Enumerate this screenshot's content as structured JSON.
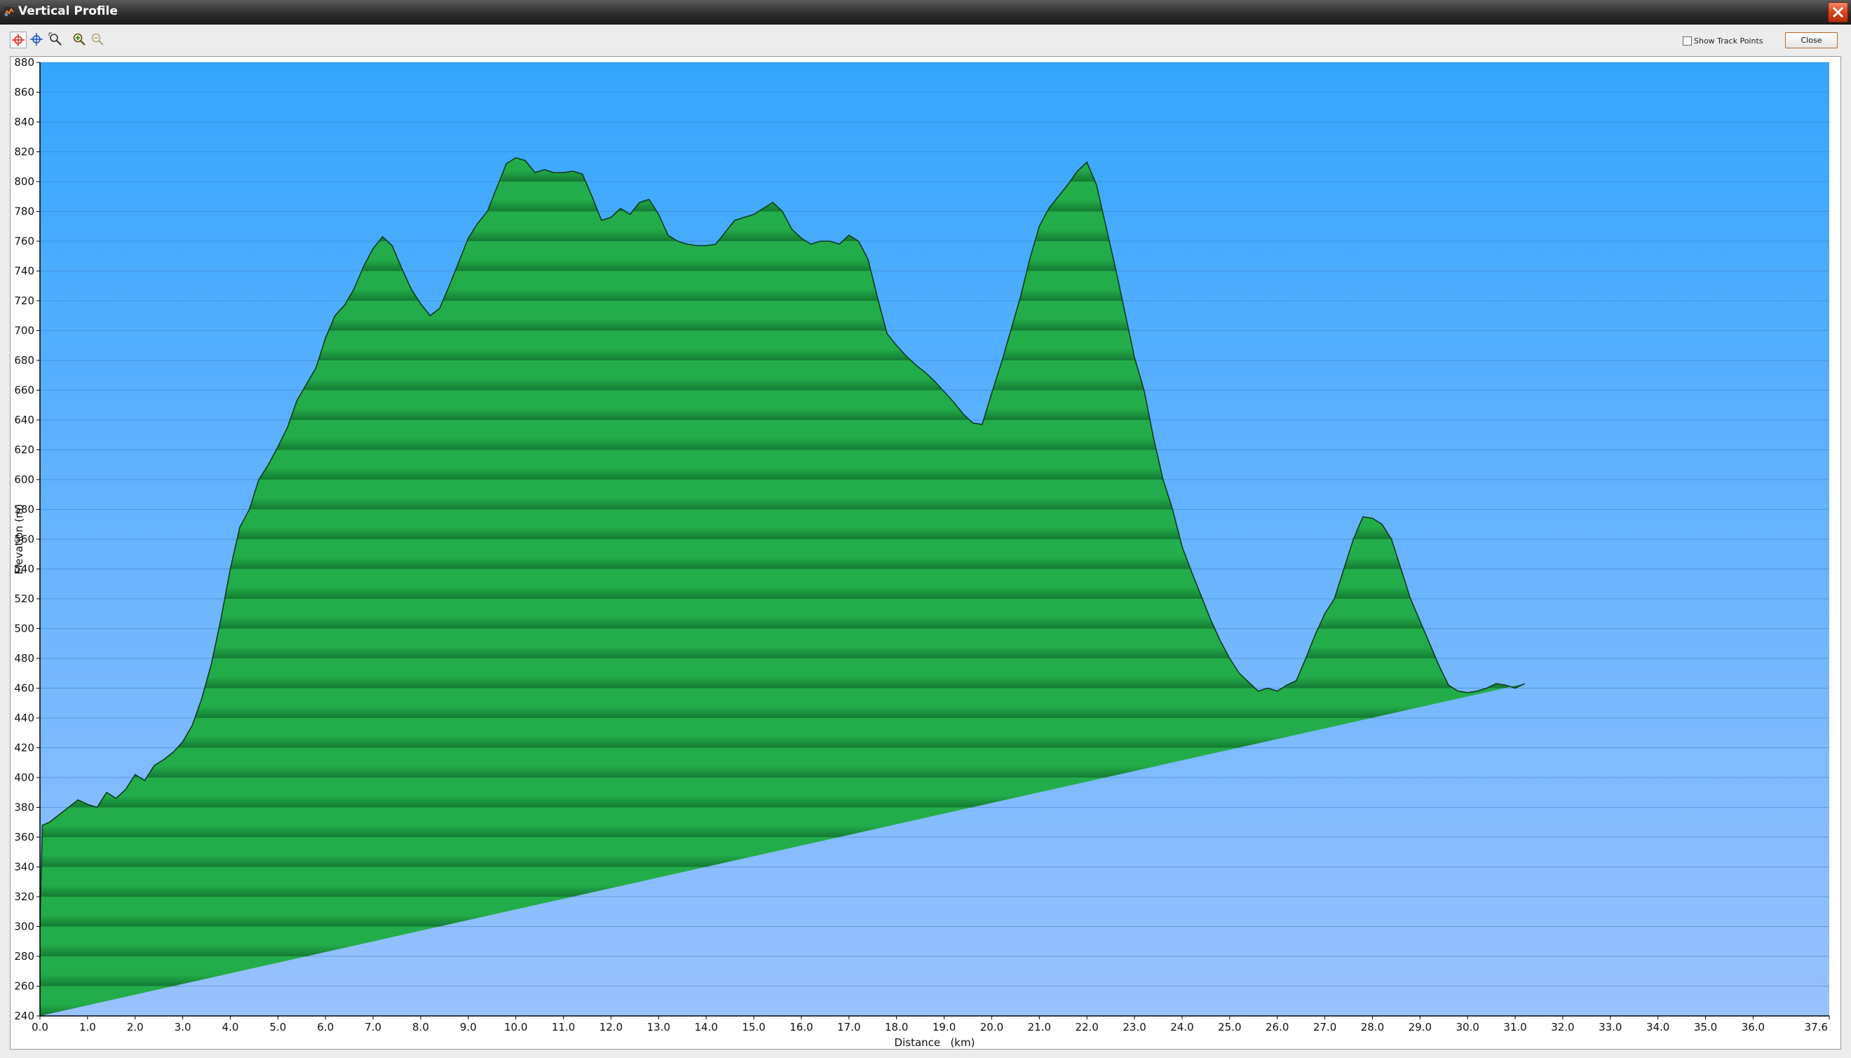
{
  "window": {
    "title": "Vertical Profile",
    "icon": "profile-app-icon",
    "close_icon": "close-icon"
  },
  "toolbar": {
    "tools": [
      {
        "name": "select-point-tool",
        "icon": "red-crosshair-icon",
        "active": true
      },
      {
        "name": "pan-crosshair-tool",
        "icon": "blue-crosshair-icon",
        "active": false
      },
      {
        "name": "zoom-region-tool",
        "icon": "zoom-region-icon",
        "active": false
      },
      {
        "name": "zoom-in-tool",
        "icon": "zoom-in-icon",
        "active": false
      },
      {
        "name": "zoom-out-tool",
        "icon": "zoom-out-icon",
        "active": false
      }
    ],
    "show_track_points_label": "Show Track Points",
    "show_track_points_checked": false,
    "close_label": "Close"
  },
  "colors": {
    "sky_top": "#35a6fd",
    "sky_bottom": "#99c1ff",
    "fill_light": "#23ad4a",
    "fill_dark": "#147a33",
    "outline": "#0d3a1a",
    "grid": "#3b7fc4"
  },
  "chart_data": {
    "type": "area",
    "xlabel": "Distance   (km)",
    "ylabel": "Elevation (m)",
    "xlim": [
      0,
      37.6
    ],
    "ylim": [
      240,
      880
    ],
    "grid": true,
    "x_ticks": [
      "0.0",
      "1.0",
      "2.0",
      "3.0",
      "4.0",
      "5.0",
      "6.0",
      "7.0",
      "8.0",
      "9.0",
      "10.0",
      "11.0",
      "12.0",
      "13.0",
      "14.0",
      "15.0",
      "16.0",
      "17.0",
      "18.0",
      "19.0",
      "20.0",
      "21.0",
      "22.0",
      "23.0",
      "24.0",
      "25.0",
      "26.0",
      "27.0",
      "28.0",
      "29.0",
      "30.0",
      "31.0",
      "32.0",
      "33.0",
      "34.0",
      "35.0",
      "36.0",
      "37.6"
    ],
    "y_ticks": [
      "880",
      "860",
      "840",
      "820",
      "800",
      "780",
      "760",
      "740",
      "720",
      "700",
      "680",
      "660",
      "640",
      "620",
      "600",
      "580",
      "560",
      "540",
      "520",
      "500",
      "480",
      "460",
      "440",
      "420",
      "400",
      "380",
      "360",
      "340",
      "320",
      "300",
      "280",
      "260",
      "240"
    ],
    "x": [
      0.0,
      0.05,
      0.2,
      0.4,
      0.6,
      0.8,
      1.0,
      1.2,
      1.4,
      1.6,
      1.8,
      2.0,
      2.2,
      2.4,
      2.6,
      2.8,
      3.0,
      3.2,
      3.4,
      3.6,
      3.8,
      4.0,
      4.2,
      4.4,
      4.6,
      4.8,
      5.0,
      5.2,
      5.4,
      5.6,
      5.8,
      6.0,
      6.2,
      6.4,
      6.6,
      6.8,
      7.0,
      7.2,
      7.4,
      7.6,
      7.8,
      8.0,
      8.2,
      8.4,
      8.6,
      8.8,
      9.0,
      9.2,
      9.4,
      9.6,
      9.8,
      10.0,
      10.2,
      10.4,
      10.6,
      10.8,
      11.0,
      11.2,
      11.4,
      11.6,
      11.8,
      12.0,
      12.2,
      12.4,
      12.6,
      12.8,
      13.0,
      13.2,
      13.4,
      13.6,
      13.8,
      14.0,
      14.2,
      14.4,
      14.6,
      14.8,
      15.0,
      15.2,
      15.4,
      15.6,
      15.8,
      16.0,
      16.2,
      16.4,
      16.6,
      16.8,
      17.0,
      17.2,
      17.4,
      17.6,
      17.8,
      18.0,
      18.2,
      18.4,
      18.6,
      18.8,
      19.0,
      19.2,
      19.4,
      19.6,
      19.8,
      20.0,
      20.2,
      20.4,
      20.6,
      20.8,
      21.0,
      21.2,
      21.4,
      21.6,
      21.8,
      22.0,
      22.2,
      22.4,
      22.6,
      22.8,
      23.0,
      23.2,
      23.4,
      23.6,
      23.8,
      24.0,
      24.2,
      24.4,
      24.6,
      24.8,
      25.0,
      25.2,
      25.4,
      25.6,
      25.8,
      26.0,
      26.2,
      26.4,
      26.6,
      26.8,
      27.0,
      27.2,
      27.4,
      27.6,
      27.8,
      28.0,
      28.2,
      28.4,
      28.6,
      28.8,
      29.0,
      29.2,
      29.4,
      29.6,
      29.8,
      30.0,
      30.2,
      30.4,
      30.6,
      30.8,
      31.0,
      31.2,
      31.4,
      31.6,
      31.8,
      32.0,
      32.2,
      32.4,
      32.6,
      32.8,
      33.0,
      33.2,
      33.4,
      33.6,
      33.8,
      34.0,
      34.2,
      34.4,
      34.6,
      34.8,
      35.0,
      35.2,
      35.4,
      35.6,
      35.8,
      36.0,
      36.2,
      36.4,
      36.6,
      36.8,
      37.0,
      37.2,
      37.4,
      37.6
    ],
    "series": [
      {
        "values": [
          300,
          368,
          370,
          375,
          380,
          385,
          382,
          380,
          390,
          386,
          392,
          402,
          398,
          408,
          412,
          417,
          424,
          435,
          453,
          476,
          506,
          540,
          568,
          580,
          600,
          610,
          622,
          635,
          653,
          664,
          675,
          695,
          710,
          717,
          728,
          743,
          755,
          763,
          757,
          742,
          728,
          718,
          710,
          715,
          730,
          746,
          762,
          772,
          780,
          796,
          812,
          816,
          814,
          806,
          808,
          806,
          806,
          807,
          805,
          790,
          774,
          776,
          782,
          778,
          786,
          788,
          778,
          764,
          760,
          758,
          757,
          757,
          758,
          766,
          774,
          776,
          778,
          782,
          786,
          780,
          768,
          762,
          758,
          760,
          760,
          758,
          764,
          760,
          748,
          722,
          698,
          690,
          683,
          677,
          672,
          666,
          659,
          652,
          644,
          638,
          637,
          658,
          678,
          700,
          722,
          748,
          770,
          782,
          790,
          798,
          807,
          813,
          798,
          770,
          742,
          712,
          682,
          660,
          628,
          600,
          580,
          555,
          538,
          522,
          506,
          492,
          480,
          470,
          464,
          458,
          460,
          458,
          462,
          465,
          480,
          496,
          510,
          520,
          540,
          560,
          575,
          574,
          570,
          560,
          540,
          520,
          505,
          490,
          475,
          462,
          458,
          457,
          458,
          460,
          463,
          462,
          460,
          463
        ]
      }
    ]
  }
}
